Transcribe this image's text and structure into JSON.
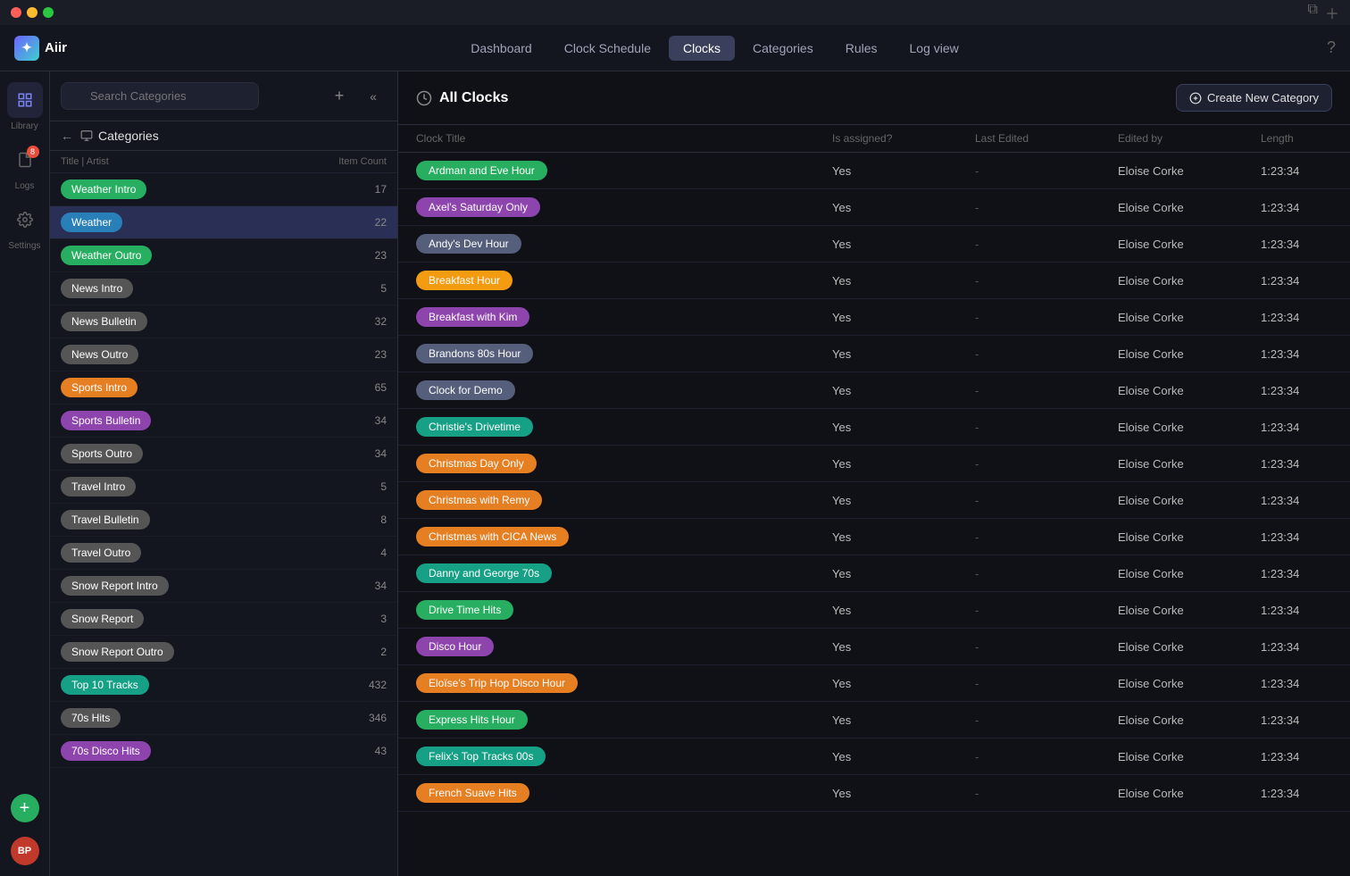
{
  "titlebar": {
    "title": "",
    "window_controls": [
      "red",
      "yellow",
      "green"
    ]
  },
  "topnav": {
    "logo": "Aiir",
    "items": [
      {
        "label": "Dashboard",
        "active": false
      },
      {
        "label": "Clock Schedule",
        "active": false
      },
      {
        "label": "Clocks",
        "active": true
      },
      {
        "label": "Categories",
        "active": false
      },
      {
        "label": "Rules",
        "active": false
      },
      {
        "label": "Log view",
        "active": false
      }
    ]
  },
  "icon_sidebar": {
    "items": [
      {
        "name": "library",
        "label": "Library",
        "icon": "☰",
        "active": true
      },
      {
        "name": "logs",
        "label": "Logs",
        "icon": "📋",
        "active": false,
        "badge": "8"
      },
      {
        "name": "settings",
        "label": "Settings",
        "icon": "⚙",
        "active": false
      }
    ],
    "avatar": "BP",
    "add_label": "+"
  },
  "panel": {
    "search_placeholder": "Search Categories",
    "nav_title": "Categories",
    "col_title": "Title | Artist",
    "col_count": "Item Count",
    "create_category_label": "Create New Category"
  },
  "categories": [
    {
      "label": "Weather Intro",
      "color": "#27ae60",
      "count": 17,
      "active": false
    },
    {
      "label": "Weather",
      "color": "#2980b9",
      "count": 22,
      "active": true
    },
    {
      "label": "Weather Outro",
      "color": "#27ae60",
      "count": 23,
      "active": false
    },
    {
      "label": "News Intro",
      "color": "#555",
      "count": 5,
      "active": false
    },
    {
      "label": "News Bulletin",
      "color": "#555",
      "count": 32,
      "active": false
    },
    {
      "label": "News Outro",
      "color": "#555",
      "count": 23,
      "active": false
    },
    {
      "label": "Sports Intro",
      "color": "#e67e22",
      "count": 65,
      "active": false
    },
    {
      "label": "Sports Bulletin",
      "color": "#8e44ad",
      "count": 34,
      "active": false
    },
    {
      "label": "Sports Outro",
      "color": "#555",
      "count": 34,
      "active": false
    },
    {
      "label": "Travel Intro",
      "color": "#555",
      "count": 5,
      "active": false
    },
    {
      "label": "Travel Bulletin",
      "color": "#555",
      "count": 8,
      "active": false
    },
    {
      "label": "Travel Outro",
      "color": "#555",
      "count": 4,
      "active": false
    },
    {
      "label": "Snow Report Intro",
      "color": "#555",
      "count": 34,
      "active": false
    },
    {
      "label": "Snow Report",
      "color": "#555",
      "count": 3,
      "active": false
    },
    {
      "label": "Snow Report Outro",
      "color": "#555",
      "count": 2,
      "active": false
    },
    {
      "label": "Top 10 Tracks",
      "color": "#16a085",
      "count": 432,
      "active": false
    },
    {
      "label": "70s Hits",
      "color": "#555",
      "count": 346,
      "active": false
    },
    {
      "label": "70s Disco Hits",
      "color": "#8e44ad",
      "count": 43,
      "active": false
    }
  ],
  "clocks_panel": {
    "title": "All Clocks",
    "columns": [
      "Clock Title",
      "Is assigned?",
      "Last Edited",
      "Edited by",
      "Length"
    ],
    "create_label": "Create New Category"
  },
  "clocks": [
    {
      "title": "Ardman and Eve Hour",
      "color": "#27ae60",
      "assigned": "Yes",
      "last_edited": "-",
      "edited_by": "Eloise Corke",
      "length": "1:23:34"
    },
    {
      "title": "Axel's Saturday Only",
      "color": "#8e44ad",
      "assigned": "Yes",
      "last_edited": "-",
      "edited_by": "Eloise Corke",
      "length": "1:23:34"
    },
    {
      "title": "Andy's Dev Hour",
      "color": "#555e7a",
      "assigned": "Yes",
      "last_edited": "-",
      "edited_by": "Eloise Corke",
      "length": "1:23:34"
    },
    {
      "title": "Breakfast Hour",
      "color": "#f39c12",
      "assigned": "Yes",
      "last_edited": "-",
      "edited_by": "Eloise Corke",
      "length": "1:23:34"
    },
    {
      "title": "Breakfast with Kim",
      "color": "#8e44ad",
      "assigned": "Yes",
      "last_edited": "-",
      "edited_by": "Eloise Corke",
      "length": "1:23:34"
    },
    {
      "title": "Brandons 80s Hour",
      "color": "#555e7a",
      "assigned": "Yes",
      "last_edited": "-",
      "edited_by": "Eloise Corke",
      "length": "1:23:34"
    },
    {
      "title": "Clock for Demo",
      "color": "#555e7a",
      "assigned": "Yes",
      "last_edited": "-",
      "edited_by": "Eloise Corke",
      "length": "1:23:34"
    },
    {
      "title": "Christie's Drivetime",
      "color": "#16a085",
      "assigned": "Yes",
      "last_edited": "-",
      "edited_by": "Eloise Corke",
      "length": "1:23:34"
    },
    {
      "title": "Christmas Day Only",
      "color": "#e67e22",
      "assigned": "Yes",
      "last_edited": "-",
      "edited_by": "Eloise Corke",
      "length": "1:23:34"
    },
    {
      "title": "Christmas with Remy",
      "color": "#e67e22",
      "assigned": "Yes",
      "last_edited": "-",
      "edited_by": "Eloise Corke",
      "length": "1:23:34"
    },
    {
      "title": "Christmas with CICA News",
      "color": "#e67e22",
      "assigned": "Yes",
      "last_edited": "-",
      "edited_by": "Eloise Corke",
      "length": "1:23:34"
    },
    {
      "title": "Danny and George 70s",
      "color": "#16a085",
      "assigned": "Yes",
      "last_edited": "-",
      "edited_by": "Eloise Corke",
      "length": "1:23:34"
    },
    {
      "title": "Drive Time Hits",
      "color": "#27ae60",
      "assigned": "Yes",
      "last_edited": "-",
      "edited_by": "Eloise Corke",
      "length": "1:23:34"
    },
    {
      "title": "Disco Hour",
      "color": "#8e44ad",
      "assigned": "Yes",
      "last_edited": "-",
      "edited_by": "Eloise Corke",
      "length": "1:23:34"
    },
    {
      "title": "Eloïse's Trip Hop Disco Hour",
      "color": "#e67e22",
      "assigned": "Yes",
      "last_edited": "-",
      "edited_by": "Eloise Corke",
      "length": "1:23:34"
    },
    {
      "title": "Express Hits Hour",
      "color": "#27ae60",
      "assigned": "Yes",
      "last_edited": "-",
      "edited_by": "Eloise Corke",
      "length": "1:23:34"
    },
    {
      "title": "Felix's Top Tracks 00s",
      "color": "#16a085",
      "assigned": "Yes",
      "last_edited": "-",
      "edited_by": "Eloise Corke",
      "length": "1:23:34"
    },
    {
      "title": "French Suave Hits",
      "color": "#e67e22",
      "assigned": "Yes",
      "last_edited": "-",
      "edited_by": "Eloise Corke",
      "length": "1:23:34"
    }
  ]
}
